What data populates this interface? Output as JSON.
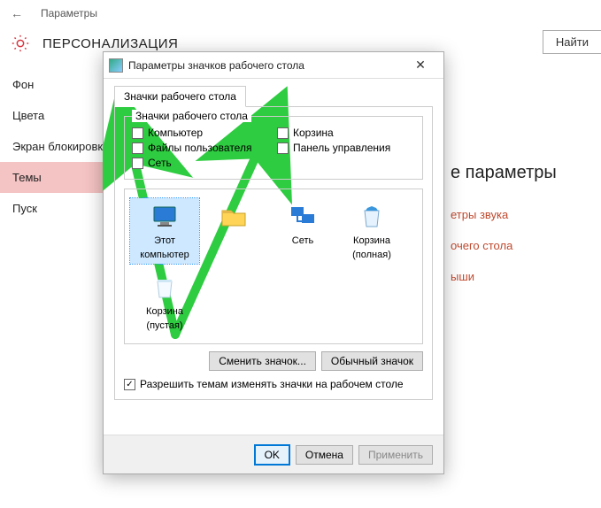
{
  "header": {
    "breadcrumb": "Параметры",
    "title": "ПЕРСОНАЛИЗАЦИЯ",
    "search": "Найти"
  },
  "sidebar": {
    "items": [
      {
        "label": "Фон"
      },
      {
        "label": "Цвета"
      },
      {
        "label": "Экран блокировки"
      },
      {
        "label": "Темы",
        "active": true
      },
      {
        "label": "Пуск"
      }
    ]
  },
  "content": {
    "heading": "е параметры",
    "links": [
      "етры звука",
      "очего стола",
      "ыши"
    ]
  },
  "dialog": {
    "title": "Параметры значков рабочего стола",
    "tab": "Значки рабочего стола",
    "group_legend": "Значки рабочего стола",
    "checks": {
      "computer": "Компьютер",
      "userfiles": "Файлы пользователя",
      "network": "Сеть",
      "recycle": "Корзина",
      "control": "Панель управления"
    },
    "icons": [
      {
        "label1": "Этот",
        "label2": "компьютер",
        "kind": "pc",
        "selected": true
      },
      {
        "label1": "",
        "label2": "",
        "kind": "folder"
      },
      {
        "label1": "Сеть",
        "label2": "",
        "kind": "net"
      },
      {
        "label1": "Корзина",
        "label2": "(полная)",
        "kind": "bin-full"
      },
      {
        "label1": "Корзина",
        "label2": "(пустая)",
        "kind": "bin-empty"
      }
    ],
    "change_icon": "Сменить значок...",
    "default_icon": "Обычный значок",
    "allow_themes": "Разрешить темам изменять значки на рабочем столе",
    "ok": "OK",
    "cancel": "Отмена",
    "apply": "Применить"
  }
}
